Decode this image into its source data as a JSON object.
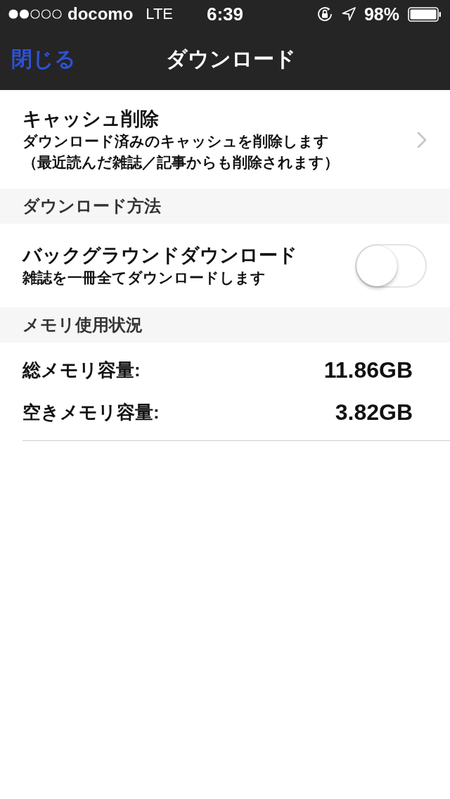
{
  "status_bar": {
    "carrier": "docomo",
    "network": "LTE",
    "time": "6:39",
    "battery": "98%"
  },
  "nav_bar": {
    "back_button": "閉じる",
    "title": "ダウンロード"
  },
  "sections": [
    {
      "rows": [
        {
          "kind": "link",
          "title": "キャッシュ削除",
          "description": [
            "ダウンロード済みのキャッシュを削除します",
            "（最近読んだ雑誌／記事からも削除されます）"
          ]
        }
      ]
    },
    {
      "header": "ダウンロード方法",
      "rows": [
        {
          "kind": "toggle",
          "title": "バックグラウンドダウンロード",
          "description": [
            "雑誌を一冊全てダウンロードします"
          ],
          "on": false
        }
      ]
    },
    {
      "header": "メモリ使用状況",
      "rows": [
        {
          "kind": "value",
          "label": "総メモリ容量:",
          "value": "11.86GB"
        },
        {
          "kind": "value",
          "label": "空きメモリ容量:",
          "value": "3.82GB"
        }
      ]
    }
  ]
}
